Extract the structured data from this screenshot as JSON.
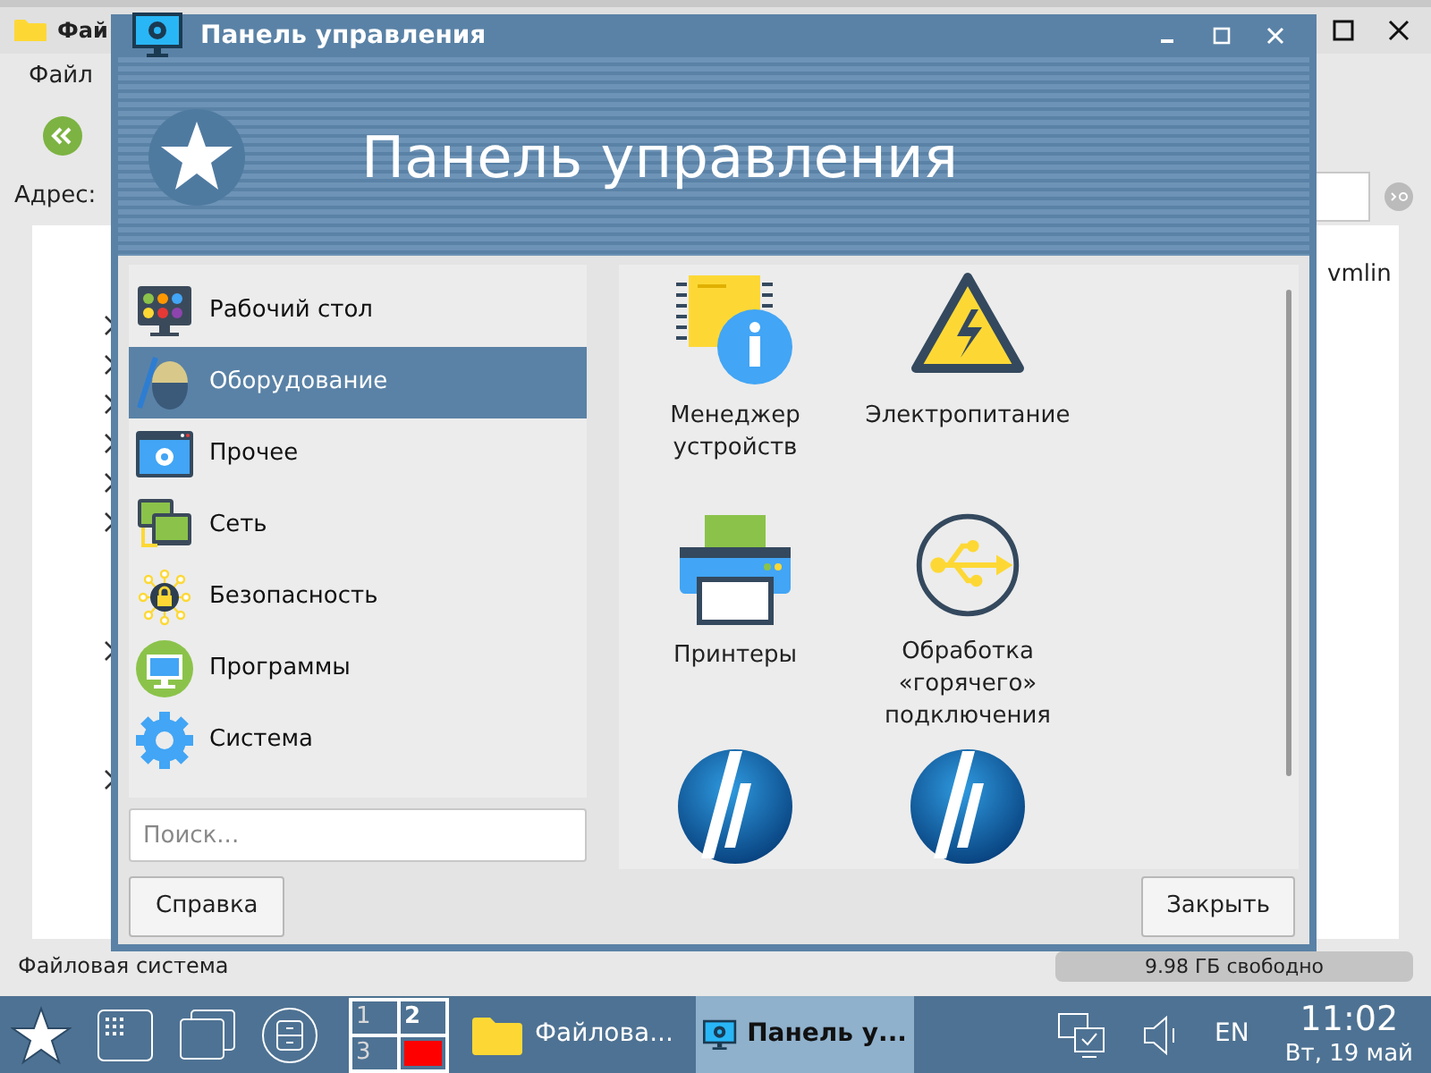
{
  "background_window": {
    "title": "Фай",
    "menu": [
      "Файл"
    ],
    "address_label": "Адрес:",
    "file": "vmlin",
    "status": "Файловая система",
    "free_space": "9.98 ГБ свободно"
  },
  "window": {
    "title": "Панель управления",
    "banner_title": "Панель управления"
  },
  "sidebar": {
    "items": [
      {
        "label": "Рабочий стол",
        "selected": false,
        "kind": "desktop"
      },
      {
        "label": "Оборудование",
        "selected": true,
        "kind": "hardware"
      },
      {
        "label": "Прочее",
        "selected": false,
        "kind": "other"
      },
      {
        "label": "Сеть",
        "selected": false,
        "kind": "network"
      },
      {
        "label": "Безопасность",
        "selected": false,
        "kind": "security"
      },
      {
        "label": "Программы",
        "selected": false,
        "kind": "programs"
      },
      {
        "label": "Система",
        "selected": false,
        "kind": "system"
      }
    ]
  },
  "search": {
    "placeholder": "Поиск..."
  },
  "applets": [
    {
      "label": "Менеджер устройств",
      "kind": "device-manager"
    },
    {
      "label": "Электропитание",
      "kind": "power"
    },
    {
      "label": "Принтеры",
      "kind": "printer"
    },
    {
      "label": "Обработка «горячего» подключения",
      "kind": "hotplug"
    },
    {
      "kind": "hp"
    },
    {
      "kind": "hp"
    }
  ],
  "buttons": {
    "help": "Справка",
    "close": "Закрыть"
  },
  "taskbar": {
    "workspaces": [
      {
        "label": "1",
        "selected": false
      },
      {
        "label": "2",
        "selected": true
      },
      {
        "label": "3",
        "selected": false
      }
    ],
    "tasks": [
      {
        "label": "Файлова...",
        "selected": false,
        "kind": "folder"
      },
      {
        "label": "Панель у...",
        "selected": true,
        "kind": "control-panel"
      }
    ],
    "language": "EN",
    "time": "11:02",
    "date": "Вт, 19 май"
  }
}
